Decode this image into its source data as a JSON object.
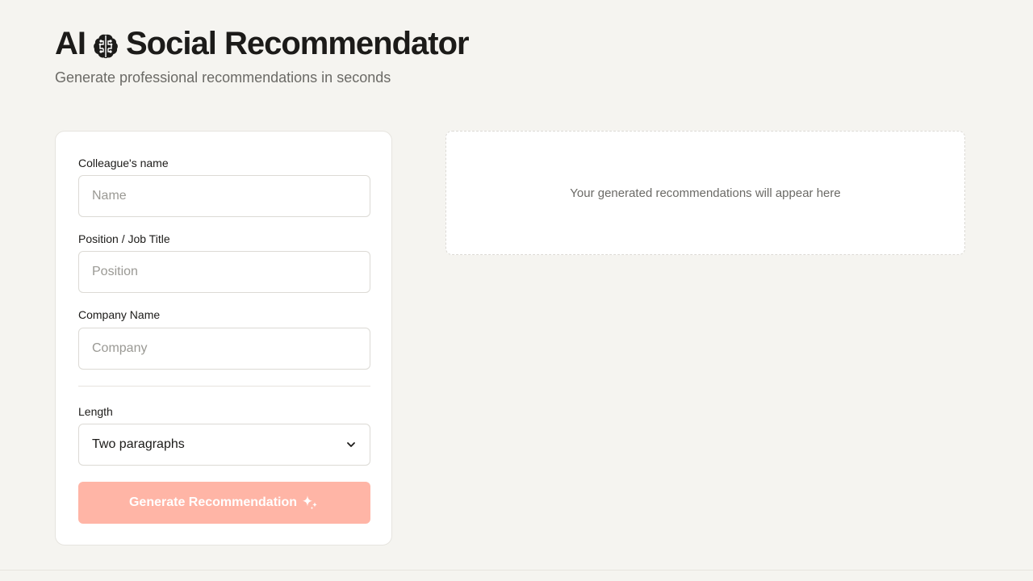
{
  "header": {
    "title_prefix": "AI",
    "title_icon": "brain-icon",
    "title_suffix": "Social Recommendator",
    "subtitle": "Generate professional recommendations in seconds"
  },
  "form": {
    "name_label": "Colleague's name",
    "name_placeholder": "Name",
    "name_value": "",
    "position_label": "Position / Job Title",
    "position_placeholder": "Position",
    "position_value": "",
    "company_label": "Company Name",
    "company_placeholder": "Company",
    "company_value": "",
    "length_label": "Length",
    "length_selected": "Two paragraphs",
    "generate_label": "Generate Recommendation",
    "generate_icon": "sparkles-icon"
  },
  "output": {
    "placeholder": "Your generated recommendations will appear here"
  },
  "colors": {
    "background": "#f5f4f0",
    "button_disabled": "#ffb5a6",
    "text_primary": "#1c1b19",
    "text_muted": "#6b6a66"
  }
}
